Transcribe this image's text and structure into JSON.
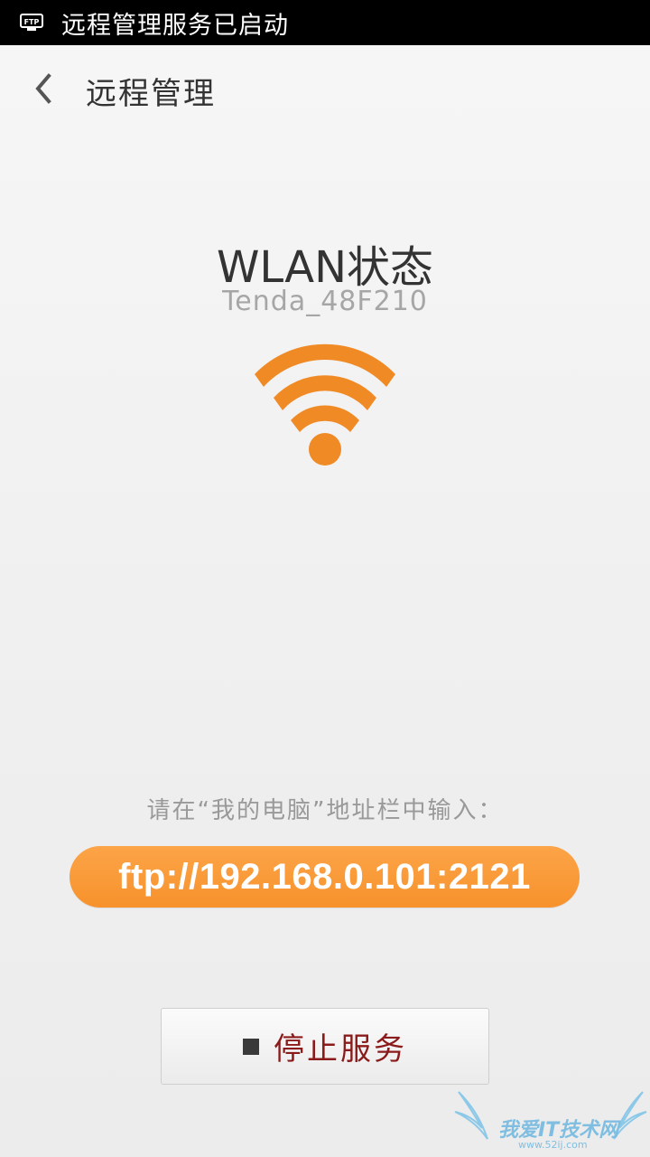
{
  "status_bar": {
    "icon": "ftp-icon",
    "icon_text": "FTP",
    "text": "远程管理服务已启动"
  },
  "header": {
    "back_icon": "chevron-left-icon",
    "title": "远程管理"
  },
  "wlan": {
    "title": "WLAN状态",
    "ssid": "Tenda_48F210",
    "icon": "wifi-icon",
    "icon_color": "#f08a24"
  },
  "connection": {
    "hint": "请在“我的电脑”地址栏中输入：",
    "ftp_address": "ftp://192.168.0.101:2121",
    "pill_color": "#f99a36"
  },
  "actions": {
    "stop_icon": "stop-icon",
    "stop_label": "停止服务",
    "stop_label_color": "#8b1a1a"
  },
  "watermark": {
    "text": "我爱IT技术网",
    "sub": "www.52ij.com"
  }
}
